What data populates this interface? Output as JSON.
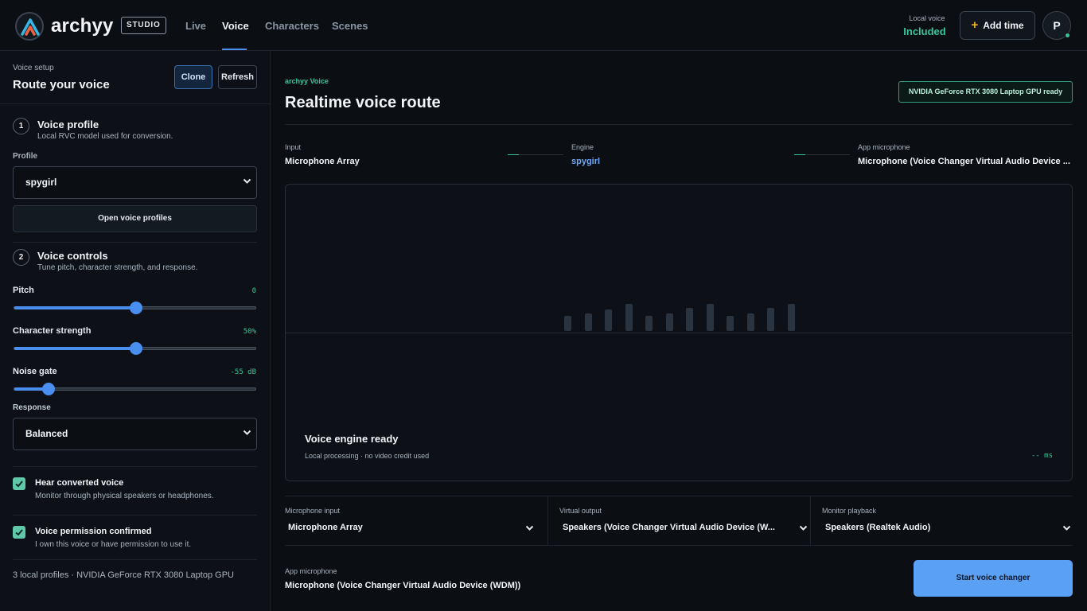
{
  "header": {
    "brand": "archyy",
    "badge": "STUDIO",
    "tabs": [
      {
        "label": "Live",
        "active": false
      },
      {
        "label": "Voice",
        "active": true
      },
      {
        "label": "Characters",
        "active": false
      },
      {
        "label": "Scenes",
        "active": false
      }
    ],
    "local_voice_label": "Local voice",
    "local_voice_value": "Included",
    "add_time_label": "Add time",
    "avatar_initial": "P",
    "accent_color": "#4a8ef0",
    "success_color": "#35c79a"
  },
  "sidebar": {
    "kicker": "Voice setup",
    "title": "Route your voice",
    "clone_label": "Clone",
    "refresh_label": "Refresh",
    "step1": {
      "number": "1",
      "title": "Voice profile",
      "desc": "Local RVC model used for conversion.",
      "profile_label": "Profile",
      "profile_value": "spygirl",
      "open_profiles_label": "Open voice profiles"
    },
    "step2": {
      "number": "2",
      "title": "Voice controls",
      "desc": "Tune pitch, character strength, and response.",
      "sliders": [
        {
          "label": "Pitch",
          "value": "0",
          "fraction": 0.5
        },
        {
          "label": "Character strength",
          "value": "50%",
          "fraction": 0.5
        },
        {
          "label": "Noise gate",
          "value": "-55 dB",
          "fraction": 0.14
        }
      ],
      "response_label": "Response",
      "response_value": "Balanced"
    },
    "checks": [
      {
        "title": "Hear converted voice",
        "desc": "Monitor through physical speakers or headphones.",
        "checked": true
      },
      {
        "title": "Voice permission confirmed",
        "desc": "I own this voice or have permission to use it.",
        "checked": true
      }
    ],
    "footer": "3 local profiles · NVIDIA GeForce RTX 3080 Laptop GPU"
  },
  "main": {
    "kicker": "archyy Voice",
    "title": "Realtime voice route",
    "gpu_badge": "NVIDIA GeForce RTX 3080 Laptop GPU ready",
    "route": {
      "input_label": "Input",
      "input_value": "Microphone Array",
      "engine_label": "Engine",
      "engine_value": "spygirl",
      "app_mic_label": "App microphone",
      "app_mic_value": "Microphone (Voice Changer Virtual Audio Device ..."
    },
    "viz": {
      "title": "Voice engine ready",
      "subtitle": "Local processing · no video credit used",
      "latency": "-- ms",
      "levels": [
        0.55,
        0.65,
        0.8,
        1.0,
        0.55,
        0.65,
        0.85,
        1.0,
        0.55,
        0.65,
        0.85,
        1.0
      ]
    },
    "devices": [
      {
        "label": "Microphone input",
        "value": "Microphone Array"
      },
      {
        "label": "Virtual output",
        "value": "Speakers (Voice Changer Virtual Audio Device (W..."
      },
      {
        "label": "Monitor playback",
        "value": "Speakers (Realtek Audio)"
      }
    ],
    "app_mic_label": "App microphone",
    "app_mic_value": "Microphone (Voice Changer Virtual Audio Device (WDM))",
    "start_label": "Start voice changer"
  }
}
